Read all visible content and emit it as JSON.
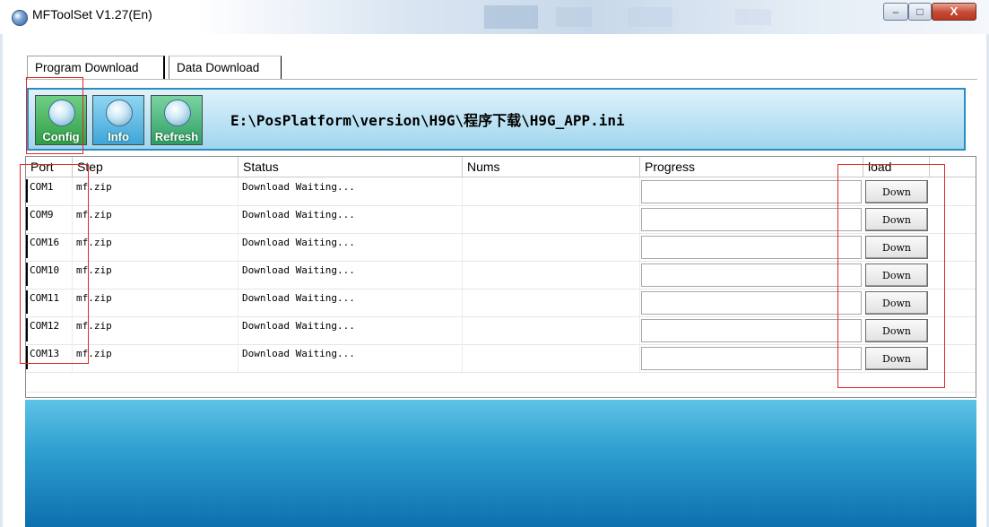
{
  "window": {
    "title": "MFToolSet V1.27(En)",
    "min_glyph": "‒",
    "max_glyph": "□",
    "close_glyph": "X"
  },
  "tabs": [
    {
      "label": "Program Download",
      "active": true
    },
    {
      "label": "Data Download",
      "active": false
    }
  ],
  "toolbar": {
    "config_label": "Config",
    "info_label": "Info",
    "refresh_label": "Refresh",
    "path": "E:\\PosPlatform\\version\\H9G\\程序下载\\H9G_APP.ini"
  },
  "table": {
    "headers": [
      "Port",
      "Step",
      "Status",
      "Nums",
      "Progress",
      "load"
    ],
    "button_label": "Down",
    "rows": [
      {
        "port": "COM1",
        "step": "mf.zip",
        "status": "Download Waiting...",
        "nums": "",
        "progress": 0
      },
      {
        "port": "COM9",
        "step": "mf.zip",
        "status": "Download Waiting...",
        "nums": "",
        "progress": 0
      },
      {
        "port": "COM16",
        "step": "mf.zip",
        "status": "Download Waiting...",
        "nums": "",
        "progress": 0
      },
      {
        "port": "COM10",
        "step": "mf.zip",
        "status": "Download Waiting...",
        "nums": "",
        "progress": 0
      },
      {
        "port": "COM11",
        "step": "mf.zip",
        "status": "Download Waiting...",
        "nums": "",
        "progress": 0
      },
      {
        "port": "COM12",
        "step": "mf.zip",
        "status": "Download Waiting...",
        "nums": "",
        "progress": 0
      },
      {
        "port": "COM13",
        "step": "mf.zip",
        "status": "Download Waiting...",
        "nums": "",
        "progress": 0
      }
    ]
  },
  "colors": {
    "highlight": "#e02828",
    "toolbar_border": "#2a8cc0",
    "bottom_panel": "#0d6fae"
  }
}
